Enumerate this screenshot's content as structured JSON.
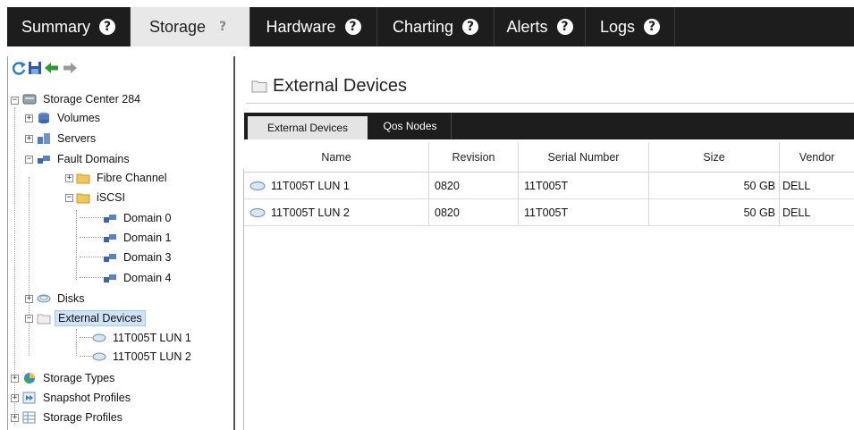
{
  "top_tabs": [
    {
      "label": "Summary",
      "active": false
    },
    {
      "label": "Storage",
      "active": true
    },
    {
      "label": "Hardware",
      "active": false
    },
    {
      "label": "Charting",
      "active": false
    },
    {
      "label": "Alerts",
      "active": false
    },
    {
      "label": "Logs",
      "active": false
    }
  ],
  "help_glyph": "?",
  "nav_toolbar": {
    "icons": [
      "refresh-icon",
      "save-icon",
      "back-arrow-icon",
      "forward-arrow-icon"
    ],
    "colors": {
      "refresh": "#2b79c7",
      "save": "#2a5aa8",
      "back": "#2e9a2e",
      "forward": "#9a9a9a"
    }
  },
  "tree": {
    "root": "Storage Center 284",
    "items": {
      "volumes": "Volumes",
      "servers": "Servers",
      "fault_domains": "Fault Domains",
      "fibre_channel": "Fibre Channel",
      "iscsi": "iSCSI",
      "domain0": "Domain 0",
      "domain1": "Domain 1",
      "domain3": "Domain 3",
      "domain4": "Domain 4",
      "disks": "Disks",
      "external_devices": "External Devices",
      "lun1": "11T005T LUN 1",
      "lun2": "11T005T LUN 2",
      "storage_types": "Storage Types",
      "snapshot_profiles": "Snapshot Profiles",
      "storage_profiles": "Storage Profiles"
    },
    "selected": "External Devices"
  },
  "main": {
    "title": "External Devices",
    "subtabs": [
      {
        "label": "External Devices",
        "active": true
      },
      {
        "label": "Qos Nodes",
        "active": false
      }
    ],
    "table": {
      "columns": [
        "Name",
        "Revision",
        "Serial Number",
        "Size",
        "Vendor"
      ],
      "rows": [
        [
          "11T005T LUN 1",
          "0820",
          "11T005T",
          "50 GB",
          "DELL"
        ],
        [
          "11T005T LUN 2",
          "0820",
          "11T005T",
          "50 GB",
          "DELL"
        ]
      ]
    }
  },
  "colors": {
    "tabbar_bg": "#1d1d1d",
    "active_tab_bg": "#e8e8e8",
    "selection_bg": "#cfe3f7",
    "folder": "#f0c75a"
  }
}
